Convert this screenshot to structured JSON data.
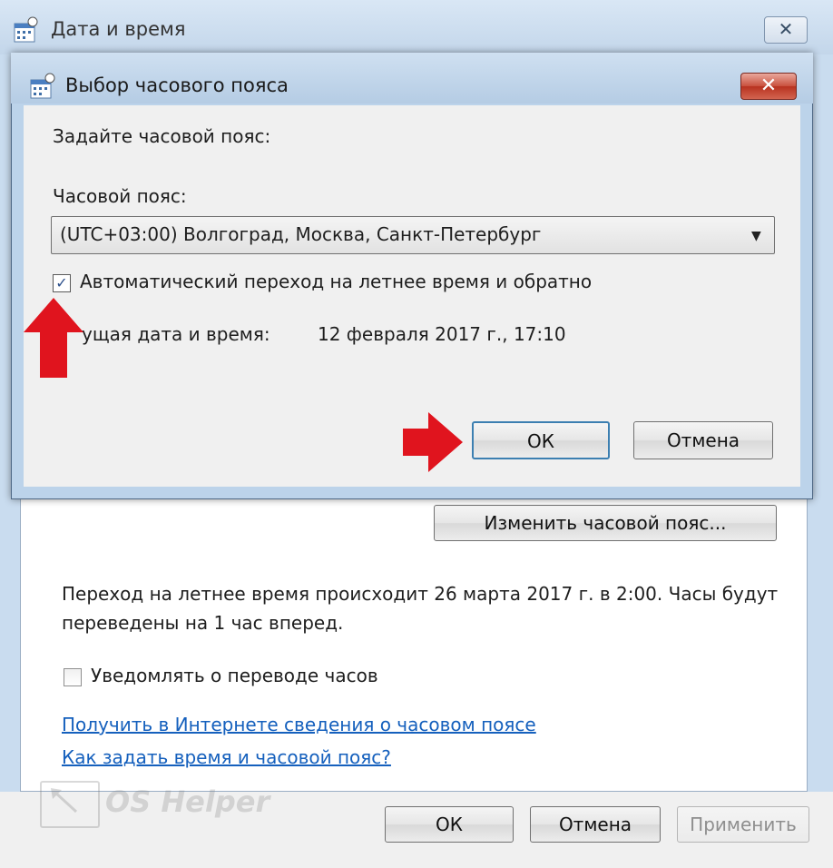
{
  "outer_window": {
    "title": "Дата и время",
    "close_glyph": "✕",
    "change_timezone_button": "Изменить часовой пояс...",
    "dst_notice": "Переход на летнее время происходит 26 марта 2017 г. в 2:00. Часы будут переведены на 1 час вперед.",
    "notify_checkbox_label": "Уведомлять о переводе часов",
    "notify_checked": false,
    "link_timezone_info": "Получить в Интернете сведения о часовом поясе",
    "link_how_to": "Как задать время и часовой пояс?",
    "ok_button": "ОК",
    "cancel_button": "Отмена",
    "apply_button": "Применить"
  },
  "dialog": {
    "title": "Выбор часового пояса",
    "close_glyph": "✕",
    "prompt": "Задайте часовой пояс:",
    "timezone_label": "Часовой пояс:",
    "timezone_value": "(UTC+03:00) Волгоград, Москва, Санкт-Петербург",
    "dropdown_glyph": "▼",
    "auto_dst_label": "Автоматический переход на летнее время и обратно",
    "auto_dst_checked": true,
    "check_glyph": "✓",
    "current_datetime_label": "ущая дата и время:",
    "current_datetime_value": "12 февраля 2017 г., 17:10",
    "ok_button": "ОК",
    "cancel_button": "Отмена"
  },
  "watermark": {
    "text": "OS Helper"
  },
  "colors": {
    "annotation_arrow": "#e0141e",
    "link": "#1560bd",
    "titlebar": "#c3d6ea"
  },
  "icons": [
    "calendar-clock-icon",
    "close-icon",
    "dropdown-arrow-icon",
    "checkbox-icon",
    "red-arrow-up",
    "red-arrow-right"
  ]
}
